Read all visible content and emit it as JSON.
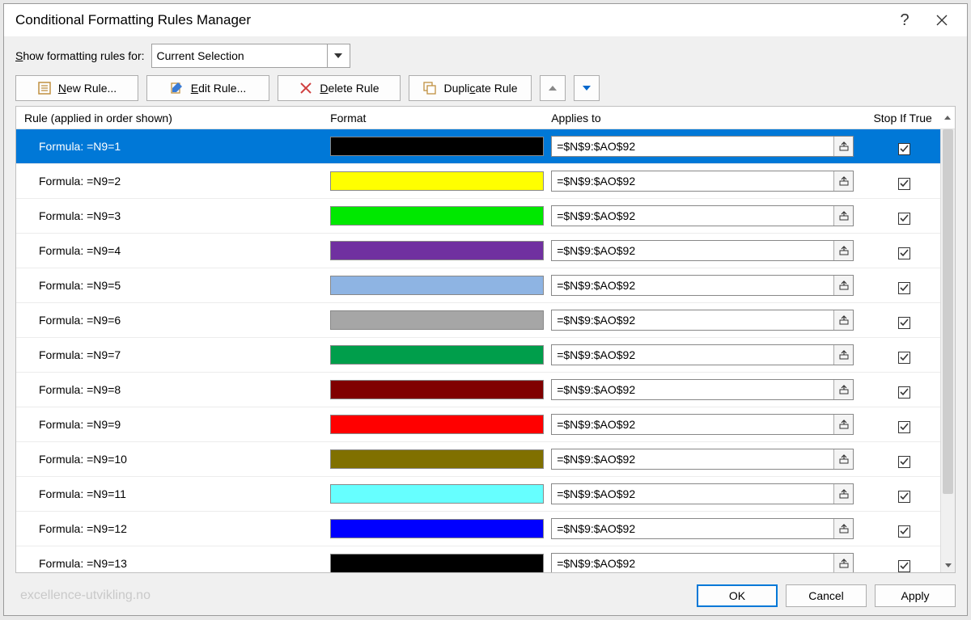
{
  "dialog": {
    "title": "Conditional Formatting Rules Manager",
    "show_for_label": "Show formatting rules for:",
    "show_for_value": "Current Selection"
  },
  "toolbar": {
    "new_rule": "New Rule...",
    "edit_rule": "Edit Rule...",
    "delete_rule": "Delete Rule",
    "duplicate_rule": "Duplicate Rule"
  },
  "headers": {
    "rule": "Rule (applied in order shown)",
    "format": "Format",
    "applies_to": "Applies to",
    "stop_if_true": "Stop If True"
  },
  "rules": [
    {
      "formula": "Formula: =N9=1",
      "color": "#000000",
      "applies": "=$N$9:$AO$92",
      "stop": true,
      "selected": true
    },
    {
      "formula": "Formula: =N9=2",
      "color": "#ffff00",
      "applies": "=$N$9:$AO$92",
      "stop": true
    },
    {
      "formula": "Formula: =N9=3",
      "color": "#00e800",
      "applies": "=$N$9:$AO$92",
      "stop": true
    },
    {
      "formula": "Formula: =N9=4",
      "color": "#7030a0",
      "applies": "=$N$9:$AO$92",
      "stop": true
    },
    {
      "formula": "Formula: =N9=5",
      "color": "#8eb4e3",
      "applies": "=$N$9:$AO$92",
      "stop": true
    },
    {
      "formula": "Formula: =N9=6",
      "color": "#a6a6a6",
      "applies": "=$N$9:$AO$92",
      "stop": true
    },
    {
      "formula": "Formula: =N9=7",
      "color": "#009e4b",
      "applies": "=$N$9:$AO$92",
      "stop": true
    },
    {
      "formula": "Formula: =N9=8",
      "color": "#800000",
      "applies": "=$N$9:$AO$92",
      "stop": true
    },
    {
      "formula": "Formula: =N9=9",
      "color": "#ff0000",
      "applies": "=$N$9:$AO$92",
      "stop": true
    },
    {
      "formula": "Formula: =N9=10",
      "color": "#807000",
      "applies": "=$N$9:$AO$92",
      "stop": true
    },
    {
      "formula": "Formula: =N9=11",
      "color": "#66ffff",
      "applies": "=$N$9:$AO$92",
      "stop": true
    },
    {
      "formula": "Formula: =N9=12",
      "color": "#0000ff",
      "applies": "=$N$9:$AO$92",
      "stop": true
    },
    {
      "formula": "Formula: =N9=13",
      "color": "#000000",
      "applies": "=$N$9:$AO$92",
      "stop": true
    }
  ],
  "footer": {
    "ok": "OK",
    "cancel": "Cancel",
    "apply": "Apply",
    "watermark": "excellence-utvikling.no"
  }
}
